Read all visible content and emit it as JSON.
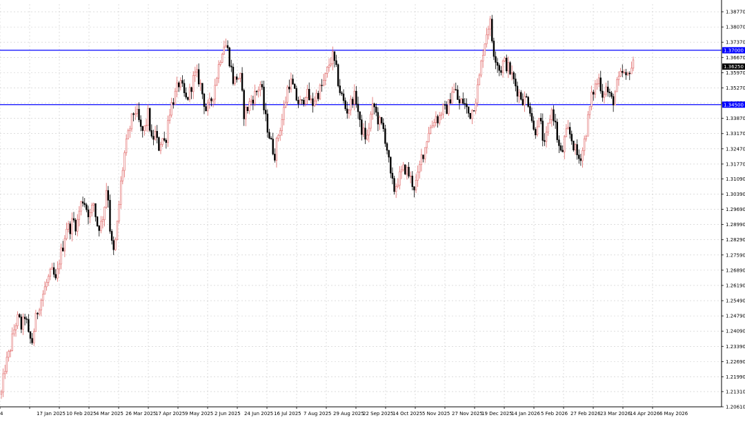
{
  "chart_data": {
    "type": "candlestick",
    "grid": true,
    "background": "#ffffff",
    "colors": {
      "bull": "#e06666",
      "bear": "#000000",
      "grid": "#c8c8c8",
      "level_line": "#0000ff",
      "level_label_bg": "#0000ff",
      "current_label_bg": "#000000",
      "axis": "#000000",
      "highlight": "#00c000"
    },
    "y_axis": {
      "min": 1.2061,
      "max": 1.3912,
      "ticks": [
        "1.38770",
        "1.38070",
        "1.37370",
        "1.36670",
        "1.35970",
        "1.35270",
        "1.34570",
        "1.33870",
        "1.33170",
        "1.32470",
        "1.31770",
        "1.31090",
        "1.30390",
        "1.29690",
        "1.28990",
        "1.28290",
        "1.27590",
        "1.26890",
        "1.26190",
        "1.25490",
        "1.24790",
        "1.24090",
        "1.23390",
        "1.22690",
        "1.21990",
        "1.21310",
        "1.20610"
      ]
    },
    "x_axis": {
      "ticks": [
        "4",
        "17 Jan 2025",
        "10 Feb 2025",
        "4 Mar 2025",
        "26 Mar 2025",
        "17 Apr 2025",
        "9 May 2025",
        "2 Jun 2025",
        "24 Jun 2025",
        "16 Jul 2025",
        "7 Aug 2025",
        "29 Aug 2025",
        "22 Sep 2025",
        "14 Oct 2025",
        "5 Nov 2025",
        "27 Nov 2025",
        "19 Dec 2025",
        "14 Jan 2026",
        "5 Feb 2026",
        "27 Feb 2026",
        "23 Mar 2026",
        "14 Apr 2026",
        "6 May 2026"
      ]
    },
    "levels": [
      {
        "value": 1.37,
        "label": "1.37000"
      },
      {
        "value": 1.345,
        "label": "1.34500"
      }
    ],
    "current_price": {
      "value": 1.3625,
      "label": "1.36250"
    },
    "closes": [
      1.212,
      1.224,
      1.229,
      1.236,
      1.244,
      1.247,
      1.242,
      1.249,
      1.238,
      1.236,
      1.246,
      1.253,
      1.257,
      1.262,
      1.266,
      1.268,
      1.263,
      1.274,
      1.28,
      1.289,
      1.288,
      1.292,
      1.289,
      1.298,
      1.302,
      1.297,
      1.294,
      1.3,
      1.29,
      1.289,
      1.296,
      1.31,
      1.283,
      1.276,
      1.291,
      1.309,
      1.322,
      1.33,
      1.337,
      1.343,
      1.339,
      1.332,
      1.334,
      1.341,
      1.328,
      1.332,
      1.325,
      1.33,
      1.327,
      1.341,
      1.346,
      1.35,
      1.355,
      1.352,
      1.347,
      1.35,
      1.356,
      1.359,
      1.356,
      1.349,
      1.342,
      1.345,
      1.35,
      1.358,
      1.366,
      1.373,
      1.372,
      1.364,
      1.355,
      1.358,
      1.357,
      1.341,
      1.343,
      1.347,
      1.349,
      1.352,
      1.355,
      1.341,
      1.334,
      1.327,
      1.322,
      1.331,
      1.337,
      1.345,
      1.355,
      1.355,
      1.349,
      1.346,
      1.345,
      1.351,
      1.348,
      1.345,
      1.349,
      1.351,
      1.354,
      1.358,
      1.364,
      1.367,
      1.361,
      1.352,
      1.347,
      1.342,
      1.344,
      1.349,
      1.347,
      1.335,
      1.332,
      1.329,
      1.339,
      1.345,
      1.339,
      1.336,
      1.333,
      1.324,
      1.311,
      1.306,
      1.31,
      1.313,
      1.316,
      1.314,
      1.31,
      1.307,
      1.312,
      1.321,
      1.325,
      1.333,
      1.335,
      1.34,
      1.338,
      1.343,
      1.342,
      1.345,
      1.352,
      1.351,
      1.345,
      1.347,
      1.344,
      1.34,
      1.343,
      1.349,
      1.358,
      1.37,
      1.378,
      1.384,
      1.37,
      1.366,
      1.36,
      1.365,
      1.363,
      1.36,
      1.356,
      1.352,
      1.349,
      1.347,
      1.348,
      1.342,
      1.331,
      1.338,
      1.335,
      1.325,
      1.334,
      1.343,
      1.338,
      1.327,
      1.321,
      1.33,
      1.333,
      1.329,
      1.324,
      1.32,
      1.323,
      1.331,
      1.341,
      1.35,
      1.354,
      1.357,
      1.35,
      1.353,
      1.349,
      1.346,
      1.353,
      1.357,
      1.36,
      1.356,
      1.362,
      1.363
    ]
  }
}
